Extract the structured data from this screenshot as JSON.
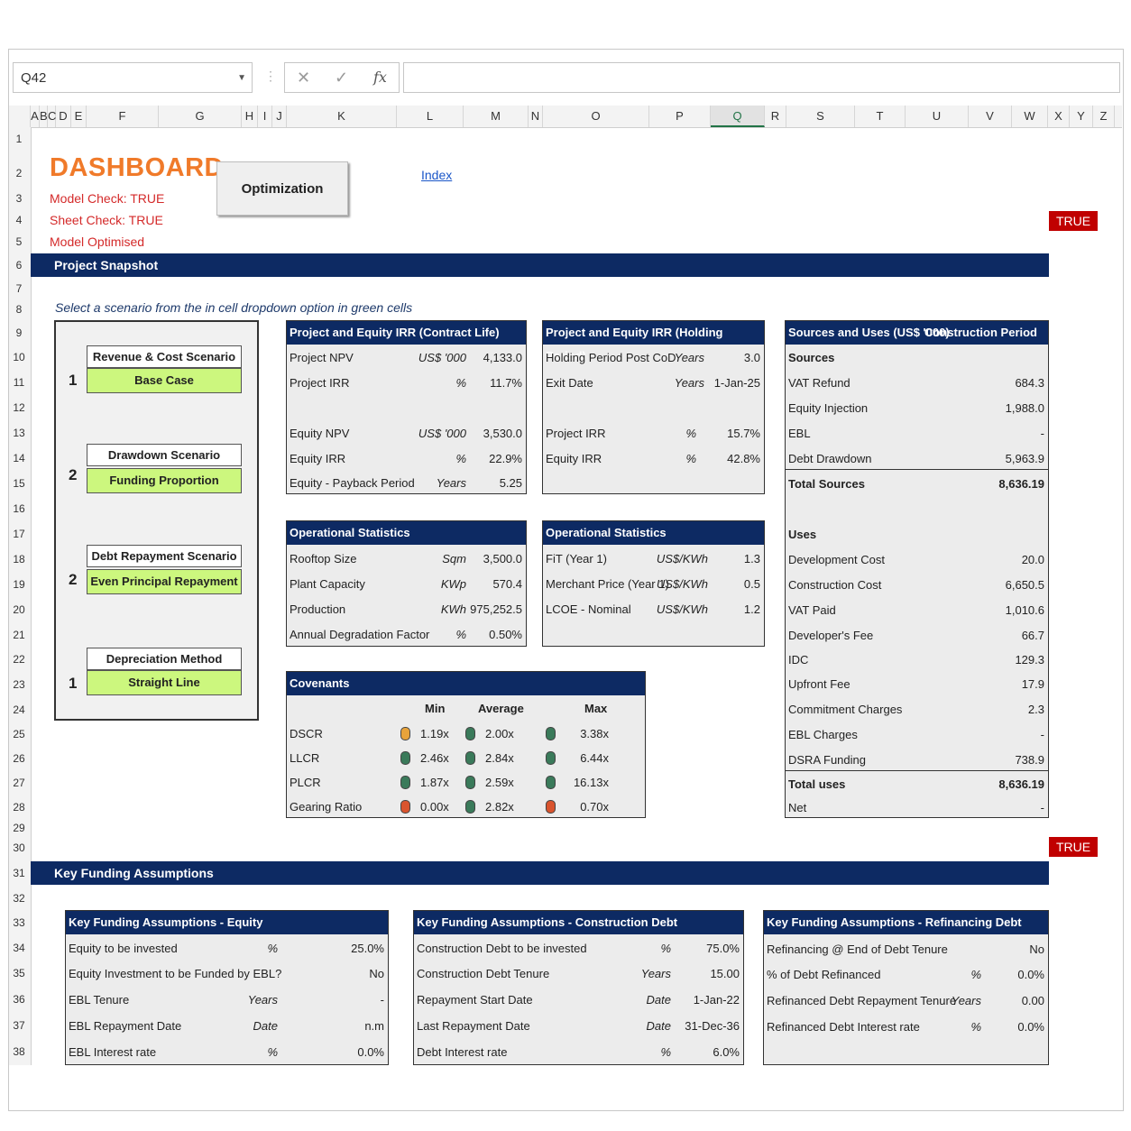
{
  "formula_bar": {
    "cell_ref": "Q42",
    "cancel_icon": "✕",
    "enter_icon": "✓",
    "fx_label": "fx"
  },
  "columns": [
    "A",
    "B",
    "C",
    "D",
    "E",
    "F",
    "G",
    "H",
    "I",
    "J",
    "K",
    "L",
    "M",
    "N",
    "O",
    "P",
    "Q",
    "R",
    "S",
    "T",
    "U",
    "V",
    "W",
    "X",
    "Y",
    "Z"
  ],
  "rows": [
    "1",
    "2",
    "3",
    "4",
    "5",
    "6",
    "7",
    "8",
    "9",
    "10",
    "11",
    "12",
    "13",
    "14",
    "15",
    "16",
    "17",
    "18",
    "19",
    "20",
    "21",
    "22",
    "23",
    "24",
    "25",
    "26",
    "27",
    "28",
    "29",
    "30",
    "31",
    "32",
    "33",
    "34",
    "35",
    "36",
    "37",
    "38"
  ],
  "header": {
    "title": "DASHBOARD",
    "model_check": "Model Check: TRUE",
    "sheet_check": "Sheet Check: TRUE",
    "model_optimised": "Model Optimised",
    "optimization_button": "Optimization",
    "index_link": "Index",
    "true_badge_top": "TRUE",
    "true_badge_bottom": "TRUE"
  },
  "sections": {
    "project_snapshot": "Project Snapshot",
    "key_funding": "Key Funding Assumptions"
  },
  "hint": "Select a scenario from the in cell dropdown option in green cells",
  "scenarios": [
    {
      "label": "Revenue & Cost Scenario",
      "value": "Base Case",
      "num": "1"
    },
    {
      "label": "Drawdown Scenario",
      "value": "Funding Proportion",
      "num": "2"
    },
    {
      "label": "Debt Repayment Scenario",
      "value": "Even Principal Repayment",
      "num": "2"
    },
    {
      "label": "Depreciation Method",
      "value": "Straight Line",
      "num": "1"
    }
  ],
  "irr_contract": {
    "title": "Project and Equity IRR (Contract Life)",
    "rows": [
      {
        "label": "Project NPV",
        "unit": "US$ '000",
        "value": "4,133.0"
      },
      {
        "label": "Project IRR",
        "unit": "%",
        "value": "11.7%"
      },
      {
        "label": "Equity NPV",
        "unit": "US$ '000",
        "value": "3,530.0"
      },
      {
        "label": "Equity IRR",
        "unit": "%",
        "value": "22.9%"
      },
      {
        "label": "Equity - Payback Period",
        "unit": "Years",
        "value": "5.25"
      }
    ]
  },
  "irr_holding": {
    "title": "Project and Equity IRR (Holding Period)",
    "rows": [
      {
        "label": "Holding Period Post CoD",
        "unit": "Years",
        "value": "3.0"
      },
      {
        "label": "Exit Date",
        "unit": "Years",
        "value": "1-Jan-25"
      },
      {
        "label": "Project IRR",
        "unit": "%",
        "value": "15.7%"
      },
      {
        "label": "Equity IRR",
        "unit": "%",
        "value": "42.8%"
      }
    ]
  },
  "op_stats_1": {
    "title": "Operational Statistics",
    "rows": [
      {
        "label": "Rooftop Size",
        "unit": "Sqm",
        "value": "3,500.0"
      },
      {
        "label": "Plant Capacity",
        "unit": "KWp",
        "value": "570.4"
      },
      {
        "label": "Production",
        "unit": "KWh",
        "value": "975,252.5"
      },
      {
        "label": "Annual Degradation Factor",
        "unit": "%",
        "value": "0.50%"
      }
    ]
  },
  "op_stats_2": {
    "title": "Operational Statistics",
    "rows": [
      {
        "label": "FiT (Year 1)",
        "unit": "US$/KWh",
        "value": "1.3"
      },
      {
        "label": "Merchant Price (Year 1)",
        "unit": "US$/KWh",
        "value": "0.5"
      },
      {
        "label": "LCOE - Nominal",
        "unit": "US$/KWh",
        "value": "1.2"
      }
    ]
  },
  "covenants": {
    "title": "Covenants",
    "headers": [
      "Min",
      "Average",
      "Max"
    ],
    "rows": [
      {
        "label": "DSCR",
        "min": "1.19x",
        "avg": "2.00x",
        "max": "3.38x",
        "min_color": "#e8a33a",
        "avg_color": "#3a7a5a",
        "max_color": "#3a7a5a"
      },
      {
        "label": "LLCR",
        "min": "2.46x",
        "avg": "2.84x",
        "max": "6.44x",
        "min_color": "#3a7a5a",
        "avg_color": "#3a7a5a",
        "max_color": "#3a7a5a"
      },
      {
        "label": "PLCR",
        "min": "1.87x",
        "avg": "2.59x",
        "max": "16.13x",
        "min_color": "#3a7a5a",
        "avg_color": "#3a7a5a",
        "max_color": "#3a7a5a"
      },
      {
        "label": "Gearing Ratio",
        "min": "0.00x",
        "avg": "2.82x",
        "max": "0.70x",
        "min_color": "#d9542e",
        "avg_color": "#3a7a5a",
        "max_color": "#d9542e"
      }
    ]
  },
  "sources_uses": {
    "title": "Sources and Uses (US$ '000)",
    "period": "Construction Period",
    "sources_label": "Sources",
    "sources": [
      {
        "label": "VAT Refund",
        "value": "684.3"
      },
      {
        "label": "Equity Injection",
        "value": "1,988.0"
      },
      {
        "label": "EBL",
        "value": "-"
      },
      {
        "label": "Debt Drawdown",
        "value": "5,963.9"
      }
    ],
    "total_sources": {
      "label": "Total Sources",
      "value": "8,636.19"
    },
    "uses_label": "Uses",
    "uses": [
      {
        "label": "Development Cost",
        "value": "20.0"
      },
      {
        "label": "Construction Cost",
        "value": "6,650.5"
      },
      {
        "label": "VAT Paid",
        "value": "1,010.6"
      },
      {
        "label": "Developer's Fee",
        "value": "66.7"
      },
      {
        "label": "IDC",
        "value": "129.3"
      },
      {
        "label": "Upfront Fee",
        "value": "17.9"
      },
      {
        "label": "Commitment Charges",
        "value": "2.3"
      },
      {
        "label": "EBL Charges",
        "value": "-"
      },
      {
        "label": "DSRA Funding",
        "value": "738.9"
      }
    ],
    "total_uses": {
      "label": "Total uses",
      "value": "8,636.19"
    },
    "net": {
      "label": "Net",
      "value": "-"
    }
  },
  "kfa_equity": {
    "title": "Key Funding Assumptions - Equity",
    "rows": [
      {
        "label": "Equity to be invested",
        "unit": "%",
        "value": "25.0%"
      },
      {
        "label": "Equity Investment to be Funded by EBL?",
        "unit": "",
        "value": "No"
      },
      {
        "label": "EBL Tenure",
        "unit": "Years",
        "value": "-"
      },
      {
        "label": "EBL Repayment Date",
        "unit": "Date",
        "value": "n.m"
      },
      {
        "label": "EBL Interest rate",
        "unit": "%",
        "value": "0.0%"
      }
    ]
  },
  "kfa_construction": {
    "title": "Key Funding Assumptions - Construction Debt",
    "rows": [
      {
        "label": "Construction Debt to be invested",
        "unit": "%",
        "value": "75.0%"
      },
      {
        "label": "Construction Debt Tenure",
        "unit": "Years",
        "value": "15.00"
      },
      {
        "label": "Repayment Start Date",
        "unit": "Date",
        "value": "1-Jan-22"
      },
      {
        "label": "Last Repayment Date",
        "unit": "Date",
        "value": "31-Dec-36"
      },
      {
        "label": "Debt Interest rate",
        "unit": "%",
        "value": "6.0%"
      }
    ]
  },
  "kfa_refinancing": {
    "title": "Key Funding Assumptions - Refinancing Debt",
    "rows": [
      {
        "label": "Refinancing @ End of Debt Tenure",
        "unit": "",
        "value": "No"
      },
      {
        "label": "% of Debt Refinanced",
        "unit": "%",
        "value": "0.0%"
      },
      {
        "label": "Refinanced Debt Repayment Tenure",
        "unit": "Years",
        "value": "0.00"
      },
      {
        "label": "Refinanced Debt Interest rate",
        "unit": "%",
        "value": "0.0%"
      }
    ]
  }
}
